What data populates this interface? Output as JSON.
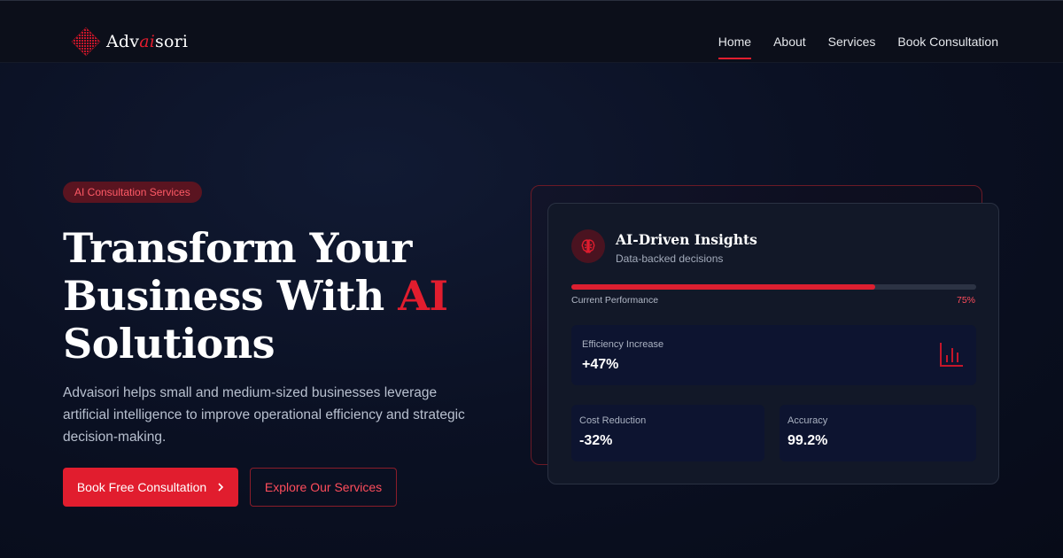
{
  "nav": {
    "logo_prefix": "Adv",
    "logo_accent": "ai",
    "logo_suffix": "sori",
    "links": [
      "Home",
      "About",
      "Services",
      "Book Consultation"
    ],
    "active": "Home"
  },
  "hero": {
    "badge": "AI Consultation Services",
    "title_line1": "Transform Your",
    "title_line2": "Business With ",
    "title_accent": "AI",
    "title_line3": "Solutions",
    "description": "Advaisori helps small and medium-sized businesses leverage artificial intelligence to improve operational efficiency and strategic decision-making.",
    "primary_button": "Book Free Consultation",
    "secondary_button": "Explore Our Services"
  },
  "card": {
    "title": "AI-Driven Insights",
    "subtitle": "Data-backed decisions",
    "performance_label": "Current Performance",
    "performance_value": "75%",
    "performance_fraction": 0.75,
    "metrics": [
      {
        "label": "Efficiency Increase",
        "value": "+47%"
      },
      {
        "label": "Cost Reduction",
        "value": "-32%"
      },
      {
        "label": "Accuracy",
        "value": "99.2%"
      }
    ]
  },
  "colors": {
    "accent": "#e11d2e",
    "background": "#0b1124",
    "card": "#121828"
  },
  "icons": [
    "logo-diamond-icon",
    "brain-icon",
    "bar-chart-icon",
    "chevron-right-icon"
  ]
}
